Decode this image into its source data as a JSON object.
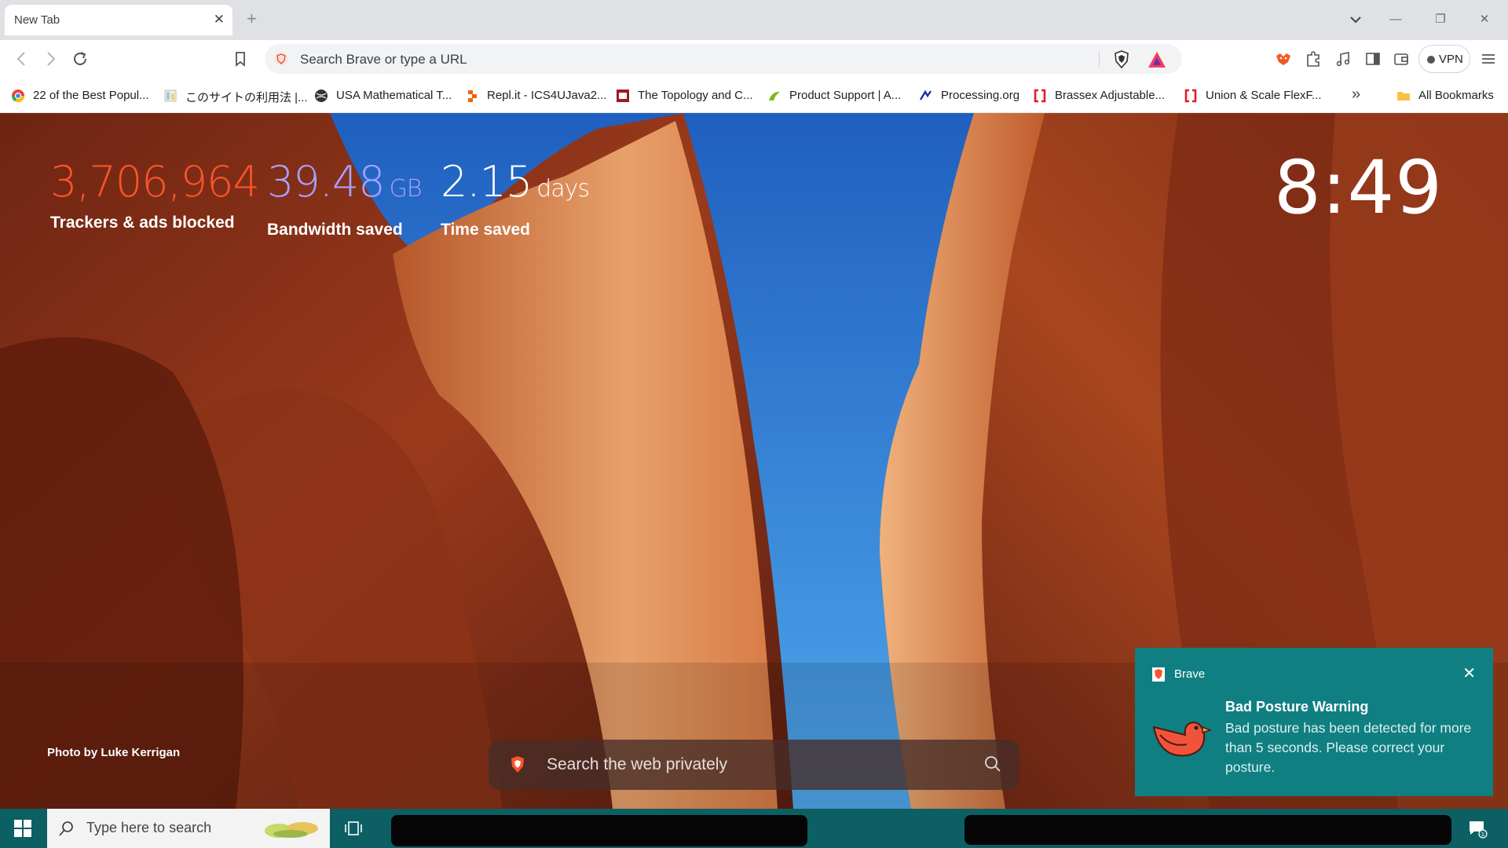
{
  "browser": {
    "tab": {
      "title": "New Tab",
      "close": "✕"
    },
    "new_tab": "+",
    "window_controls": {
      "minimize": "—",
      "maximize": "❐",
      "close": "✕"
    },
    "omnibox": {
      "placeholder": "Search Brave or type a URL"
    },
    "vpn_label": "VPN",
    "bookmarks": [
      {
        "label": "22 of the Best Popul...",
        "icon": "chrome-color-icon"
      },
      {
        "label": "このサイトの利用法 |...",
        "icon": "page-icon"
      },
      {
        "label": "USA Mathematical T...",
        "icon": "globe-icon"
      },
      {
        "label": "Repl.it - ICS4UJava2...",
        "icon": "replit-icon"
      },
      {
        "label": "The Topology and C...",
        "icon": "journal-icon"
      },
      {
        "label": "Product Support | A...",
        "icon": "acer-icon"
      },
      {
        "label": "Processing.org",
        "icon": "processing-icon"
      },
      {
        "label": "Brassex Adjustable...",
        "icon": "bracket-icon"
      },
      {
        "label": "Union & Scale FlexF...",
        "icon": "bracket-icon"
      }
    ],
    "bookmarks_more": "»",
    "all_bookmarks": "All Bookmarks"
  },
  "ntp": {
    "stats": [
      {
        "value": "3,706,964",
        "unit": "",
        "label": "Trackers & ads blocked",
        "color": "#fb542b"
      },
      {
        "value": "39.48",
        "unit": "GB",
        "label": "Bandwidth saved",
        "color": "#a6a0ff"
      },
      {
        "value": "2.15",
        "unit": "days",
        "label": "Time saved",
        "color": "#ffffff"
      }
    ],
    "clock": "8:49",
    "photo_credit": "Photo by Luke Kerrigan",
    "search_placeholder": "Search the web privately"
  },
  "notification": {
    "app": "Brave",
    "title": "Bad Posture Warning",
    "body": "Bad posture has been detected for more than 5 seconds. Please correct your posture.",
    "close": "✕",
    "background": "#107f82"
  },
  "taskbar": {
    "search_placeholder": "Type here to search"
  },
  "colors": {
    "brave_orange": "#fb542b",
    "taskbar": "#0c5f62"
  }
}
